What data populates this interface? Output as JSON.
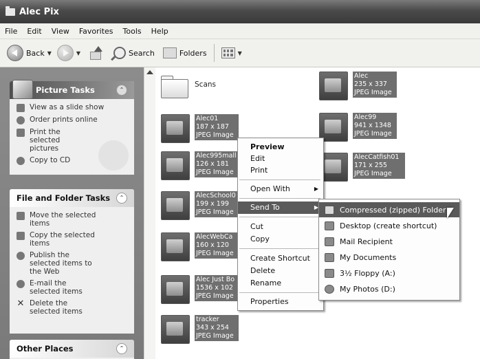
{
  "window": {
    "title": "Alec Pix"
  },
  "menubar": [
    "File",
    "Edit",
    "View",
    "Favorites",
    "Tools",
    "Help"
  ],
  "toolbar": {
    "back_label": "Back",
    "search_label": "Search",
    "folders_label": "Folders"
  },
  "picture_tasks": {
    "title": "Picture Tasks",
    "items": [
      "View as a slide show",
      "Order prints online",
      "Print the selected pictures",
      "Copy to CD"
    ]
  },
  "file_folder_tasks": {
    "title": "File and Folder Tasks",
    "items": [
      "Move the selected items",
      "Copy the selected items",
      "Publish the selected items to the Web",
      "E-mail the selected items",
      "Delete the selected items"
    ]
  },
  "other_places": {
    "title": "Other Places"
  },
  "files": [
    {
      "name": "Scans",
      "meta": "",
      "type": "folder"
    },
    {
      "name": "Alec01",
      "meta": "187 x 187\nJPEG Image",
      "type": "jpeg"
    },
    {
      "name": "Alec995mall",
      "meta": "126 x 181\nJPEG Image",
      "type": "jpeg"
    },
    {
      "name": "AlecSchool0",
      "meta": "199 x 199\nJPEG Image",
      "type": "jpeg"
    },
    {
      "name": "AlecWebCa",
      "meta": "160 x 120\nJPEG Image",
      "type": "jpeg"
    },
    {
      "name": "Alec Just Bo",
      "meta": "1536 x 102\nJPEG Image",
      "type": "jpeg"
    },
    {
      "name": "tracker",
      "meta": "343 x 254\nJPEG Image",
      "type": "jpeg"
    },
    {
      "name": "Alec",
      "meta": "235 x 337\nJPEG Image",
      "type": "jpeg"
    },
    {
      "name": "Alec99",
      "meta": "941 x 1348\nJPEG Image",
      "type": "jpeg"
    },
    {
      "name": "AlecCatfish01",
      "meta": "171 x 255\nJPEG Image",
      "type": "jpeg"
    }
  ],
  "context_menu": {
    "items": [
      "Preview",
      "Edit",
      "Print",
      "Open With",
      "Send To",
      "Cut",
      "Copy",
      "Create Shortcut",
      "Delete",
      "Rename",
      "Properties"
    ]
  },
  "send_to_menu": {
    "items": [
      "Compressed (zipped) Folder",
      "Desktop (create shortcut)",
      "Mail Recipient",
      "My Documents",
      "3½ Floppy (A:)",
      "My Photos (D:)"
    ]
  }
}
